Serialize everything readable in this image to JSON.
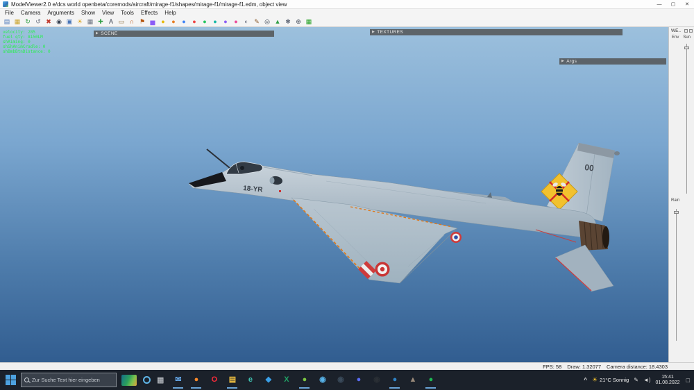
{
  "titlebar": {
    "title": "ModelViewer2.0 e/dcs world openbeta/coremods/aircraft/mirage-f1/shapes/mirage-f1/mirage-f1.edm, object view",
    "minimize_glyph": "—",
    "maximize_glyph": "▢",
    "close_glyph": "✕"
  },
  "menubar": {
    "items": [
      "File",
      "Camera",
      "Arguments",
      "Show",
      "View",
      "Tools",
      "Effects",
      "Help"
    ]
  },
  "toolbar": {
    "icons": [
      {
        "name": "save-icon",
        "glyph": "▤",
        "color": "#4a76b8"
      },
      {
        "name": "open-folder-icon",
        "glyph": "▦",
        "color": "#c9a227"
      },
      {
        "name": "reload-icon",
        "glyph": "↻",
        "color": "#2f9e44"
      },
      {
        "name": "undo-icon",
        "glyph": "↺",
        "color": "#6b7280"
      },
      {
        "name": "delete-icon",
        "glyph": "✖",
        "color": "#c0392b"
      },
      {
        "name": "camera-icon",
        "glyph": "◉",
        "color": "#374151"
      },
      {
        "name": "screenshot-icon",
        "glyph": "▣",
        "color": "#4a76b8"
      },
      {
        "name": "light-icon",
        "glyph": "☀",
        "color": "#d9a520"
      },
      {
        "name": "grid-icon",
        "glyph": "▦",
        "color": "#6b7280"
      },
      {
        "name": "axes-icon",
        "glyph": "✚",
        "color": "#2f9e44"
      },
      {
        "name": "text-icon",
        "glyph": "A",
        "color": "#374151"
      },
      {
        "name": "ruler-icon",
        "glyph": "▭",
        "color": "#8a6d3b"
      },
      {
        "name": "magnet-icon",
        "glyph": "∩",
        "color": "#b34700"
      },
      {
        "name": "flag-icon",
        "glyph": "⚑",
        "color": "#b45309"
      },
      {
        "name": "chart-icon",
        "glyph": "▅",
        "color": "#8b5cf6"
      },
      {
        "name": "palette-yellow-icon",
        "glyph": "●",
        "color": "#e6b800"
      },
      {
        "name": "palette-orange-icon",
        "glyph": "●",
        "color": "#e67e22"
      },
      {
        "name": "palette-blue-icon",
        "glyph": "●",
        "color": "#3b82f6"
      },
      {
        "name": "palette-red-icon",
        "glyph": "●",
        "color": "#ef4444"
      },
      {
        "name": "palette-green-icon",
        "glyph": "●",
        "color": "#22c55e"
      },
      {
        "name": "palette-teal-icon",
        "glyph": "●",
        "color": "#14b8a6"
      },
      {
        "name": "palette-purple-icon",
        "glyph": "●",
        "color": "#8b5cf6"
      },
      {
        "name": "palette-pink-icon",
        "glyph": "●",
        "color": "#ec4899"
      },
      {
        "name": "sphere-icon",
        "glyph": "◐",
        "color": "#6b7280"
      },
      {
        "name": "edit-icon",
        "glyph": "✎",
        "color": "#8a5a2b"
      },
      {
        "name": "target-icon",
        "glyph": "◎",
        "color": "#374151"
      },
      {
        "name": "tree-icon",
        "glyph": "▲",
        "color": "#2f9e44"
      },
      {
        "name": "settings-icon",
        "glyph": "✱",
        "color": "#6b7280"
      },
      {
        "name": "zoom-icon",
        "glyph": "⊕",
        "color": "#374151"
      },
      {
        "name": "wireframe-icon",
        "glyph": "▦",
        "color": "#22a022"
      }
    ]
  },
  "viewport": {
    "debug_lines": [
      "velocity: 285",
      "fuel qty: 8150LM",
      "shAiming: 0",
      "shShAnimCradle: 0",
      "shBmbBtnDistance: 0"
    ],
    "scene_panel": "SCENE",
    "textures_panel": "TEXTURES",
    "args_panel": "Args",
    "panel_arrow": "▶",
    "aircraft": {
      "tail_number": "00",
      "nose_code": "18-YR"
    }
  },
  "right_panel": {
    "title": "WE..",
    "env_label": "Env",
    "sun_label": "Sun",
    "rain_label": "Rain"
  },
  "statusbar": {
    "fps": "FPS: 58",
    "draw": "Draw: 1.32077",
    "camera": "Camera distance: 18.4303"
  },
  "taskbar": {
    "search_placeholder": "Zur Suche Text hier eingeben",
    "taskview_glyph": "▦",
    "apps": [
      {
        "name": "mail-app-icon",
        "glyph": "✉",
        "color": "#64a7e8",
        "active": true
      },
      {
        "name": "firefox-app-icon",
        "glyph": "●",
        "color": "#ff8a2a",
        "active": true
      },
      {
        "name": "opera-app-icon",
        "glyph": "O",
        "color": "#ff2b3a",
        "active": false
      },
      {
        "name": "file-explorer-app-icon",
        "glyph": "▤",
        "color": "#f0c040",
        "active": true
      },
      {
        "name": "edge-app-icon",
        "glyph": "e",
        "color": "#3fc1b0",
        "active": false
      },
      {
        "name": "vscode-app-icon",
        "glyph": "◆",
        "color": "#3aa0e8",
        "active": false
      },
      {
        "name": "excel-app-icon",
        "glyph": "X",
        "color": "#21a366",
        "active": false
      },
      {
        "name": "icq-app-icon",
        "glyph": "●",
        "color": "#7dc742",
        "active": true
      },
      {
        "name": "skype-app-icon",
        "glyph": "◉",
        "color": "#57b2e8",
        "active": false
      },
      {
        "name": "steam-app-icon",
        "glyph": "◉",
        "color": "#3a4a5a",
        "active": false
      },
      {
        "name": "discord-app-icon",
        "glyph": "●",
        "color": "#5a6cf2",
        "active": false
      },
      {
        "name": "obs-app-icon",
        "glyph": "◉",
        "color": "#2a2f35",
        "active": false
      },
      {
        "name": "teamspeak-app-icon",
        "glyph": "●",
        "color": "#2e84c8",
        "active": true
      },
      {
        "name": "media-app-icon",
        "glyph": "▲",
        "color": "#9a8a7a",
        "active": false
      },
      {
        "name": "spotify-app-icon",
        "glyph": "●",
        "color": "#1db954",
        "active": true
      }
    ],
    "tray": {
      "expand_glyph": "^",
      "sun_glyph": "☀",
      "weather": "21°C Sonnig",
      "pen_glyph": "✎",
      "volume_glyph": "◄)",
      "time": "15:41",
      "date": "01.08.2022",
      "notification_glyph": "□"
    }
  },
  "colors": {
    "sky_top": "#9cc0dd",
    "sky_bottom": "#315d90",
    "debug_green": "#27f04d",
    "taskbar_bg": "#1b212a"
  }
}
